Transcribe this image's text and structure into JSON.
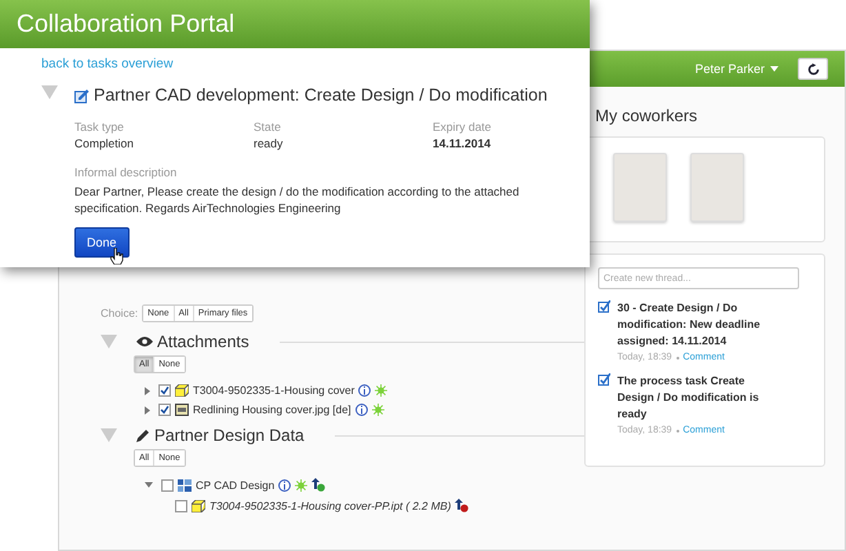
{
  "app": {
    "user": "Peter Parker",
    "choice": {
      "label": "Choice:",
      "buttons": [
        {
          "label": "None",
          "selected": false
        },
        {
          "label": "All",
          "selected": false
        },
        {
          "label": "Primary files",
          "selected": false
        }
      ]
    },
    "sections": [
      {
        "kind": "attachments",
        "title": "Attachments",
        "expanded": true,
        "filters": [
          {
            "label": "All",
            "selected": true
          },
          {
            "label": "None",
            "selected": false
          }
        ],
        "items": [
          {
            "kind": "part",
            "name": "T3004-9502335-1-Housing cover",
            "checked": true,
            "expanded": false,
            "info": true,
            "sun": true
          },
          {
            "kind": "image",
            "name": "Redlining Housing cover.jpg [de]",
            "checked": true,
            "expanded": false,
            "info": true,
            "sun": true
          }
        ]
      },
      {
        "kind": "design",
        "title": "Partner Design Data",
        "expanded": true,
        "filters": [
          {
            "label": "All",
            "selected": false
          },
          {
            "label": "None",
            "selected": false
          }
        ],
        "items": [
          {
            "kind": "assembly",
            "name": "CP CAD Design",
            "checked": false,
            "expanded": true,
            "info": true,
            "sun": true,
            "upload": true,
            "children": [
              {
                "kind": "file",
                "name": "T3004-9502335-1-Housing cover-PP.ipt ( 2.2  MB)",
                "checked": false,
                "alert": true
              }
            ]
          }
        ]
      }
    ],
    "coworkers": {
      "title": "My coworkers"
    },
    "threads": {
      "placeholder": "Create new thread...",
      "posts": [
        {
          "text": "30 - Create Design / Do modification: New deadline assigned: 14.11.2014",
          "time": "Today, 18:39",
          "link": "Comment"
        },
        {
          "text": "The process task Create Design / Do modification is ready",
          "time": "Today, 18:39",
          "link": "Comment"
        }
      ]
    }
  },
  "popup": {
    "title": "Collaboration Portal",
    "back_link": "back to tasks overview",
    "expanded": true,
    "task": {
      "title": "Partner CAD development: Create Design / Do modification",
      "fields": [
        {
          "label": "Task type",
          "value": "Completion"
        },
        {
          "label": "State",
          "value": "ready"
        },
        {
          "label": "Expiry date",
          "value": "14.11.2014"
        }
      ],
      "description_label": "Informal description",
      "description": "Dear Partner, Please create the design / do the modification according to the attached specification. Regards AirTechnologies Engineering",
      "button": "Done"
    }
  }
}
